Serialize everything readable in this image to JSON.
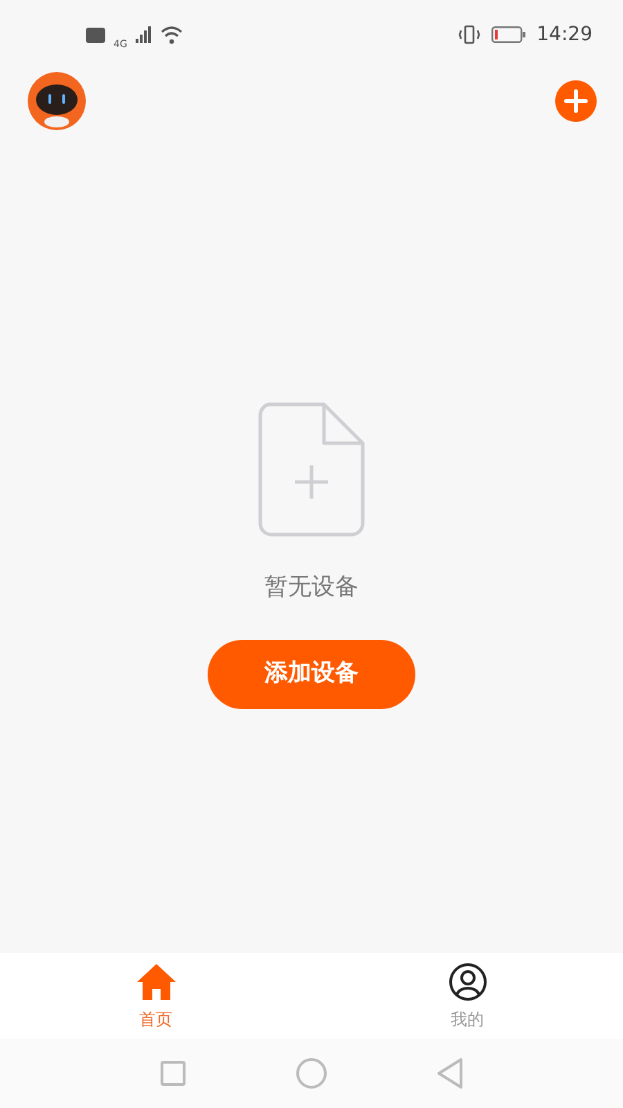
{
  "status_bar": {
    "network": "4G",
    "time": "14:29"
  },
  "empty_state": {
    "message": "暂无设备",
    "button": "添加设备"
  },
  "tabs": [
    {
      "kind": "home",
      "label": "首页",
      "selected": true
    },
    {
      "kind": "profile",
      "label": "我的",
      "selected": false
    }
  ]
}
